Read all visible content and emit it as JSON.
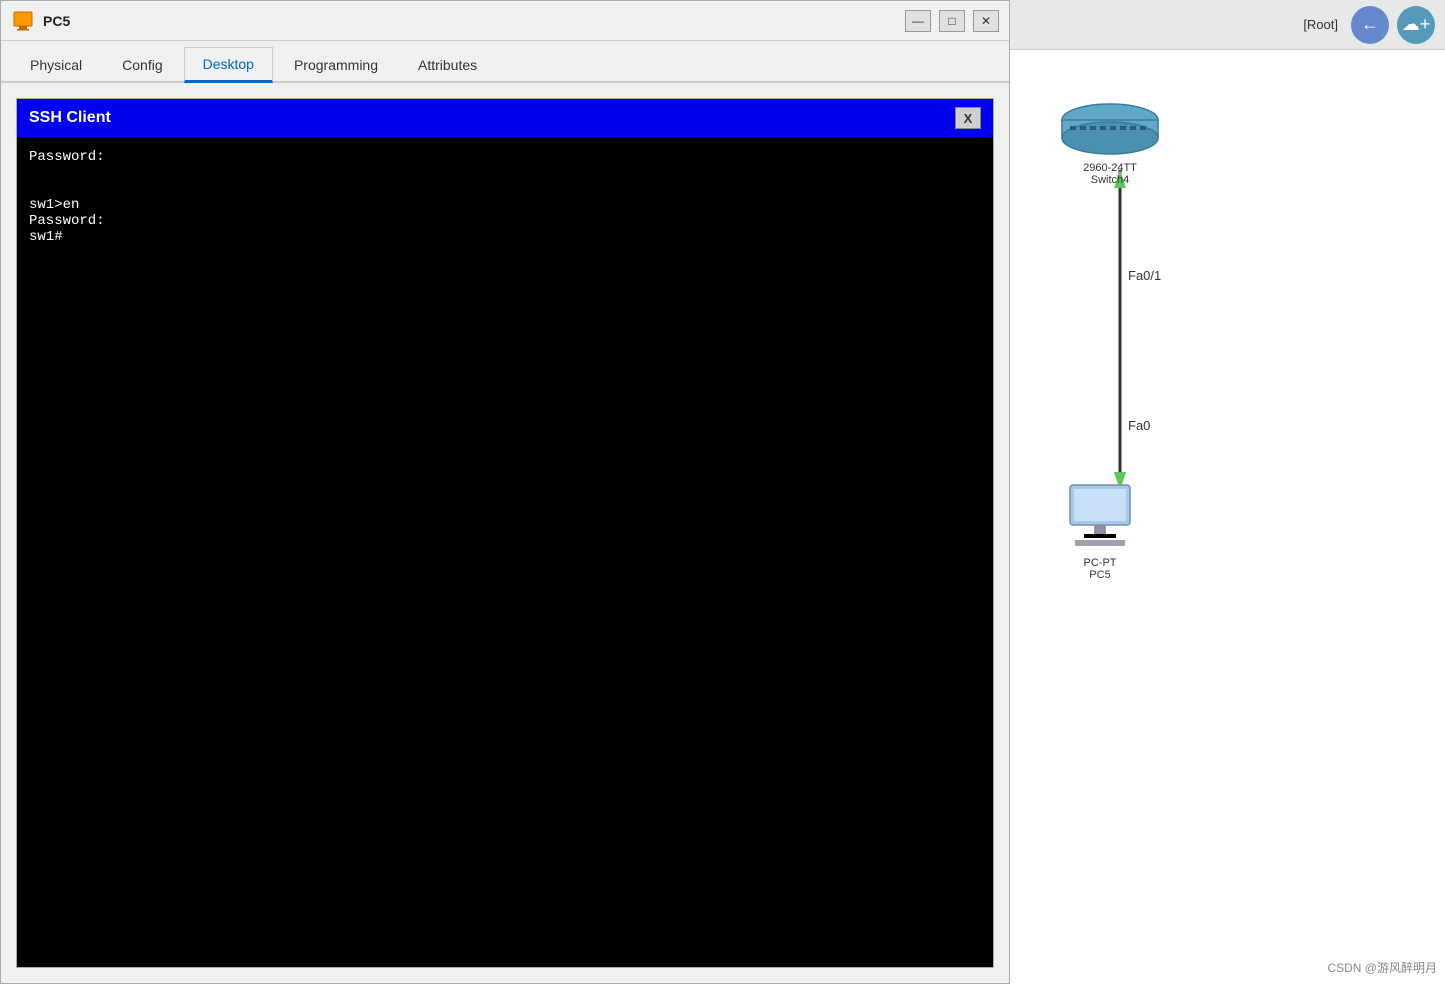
{
  "titleBar": {
    "title": "PC5",
    "minimize": "—",
    "maximize": "□",
    "close": "✕"
  },
  "tabs": [
    {
      "id": "physical",
      "label": "Physical",
      "active": false
    },
    {
      "id": "config",
      "label": "Config",
      "active": false
    },
    {
      "id": "desktop",
      "label": "Desktop",
      "active": true
    },
    {
      "id": "programming",
      "label": "Programming",
      "active": false
    },
    {
      "id": "attributes",
      "label": "Attributes",
      "active": false
    }
  ],
  "sshClient": {
    "title": "SSH Client",
    "closeLabel": "X",
    "terminalContent": "Password:\n\n\nsw1>en\nPassword:\nsw1#"
  },
  "rightPanel": {
    "rootLabel": "[Root]",
    "backIcon": "←",
    "addIcon": "☁",
    "switch": {
      "model": "2960-24TT",
      "name": "Switch4",
      "port1Label": "Fa0/1",
      "port2Label": "Fa0"
    },
    "pc": {
      "model": "PC-PT",
      "name": "PC5"
    }
  },
  "watermark": "CSDN @游风醉明月"
}
